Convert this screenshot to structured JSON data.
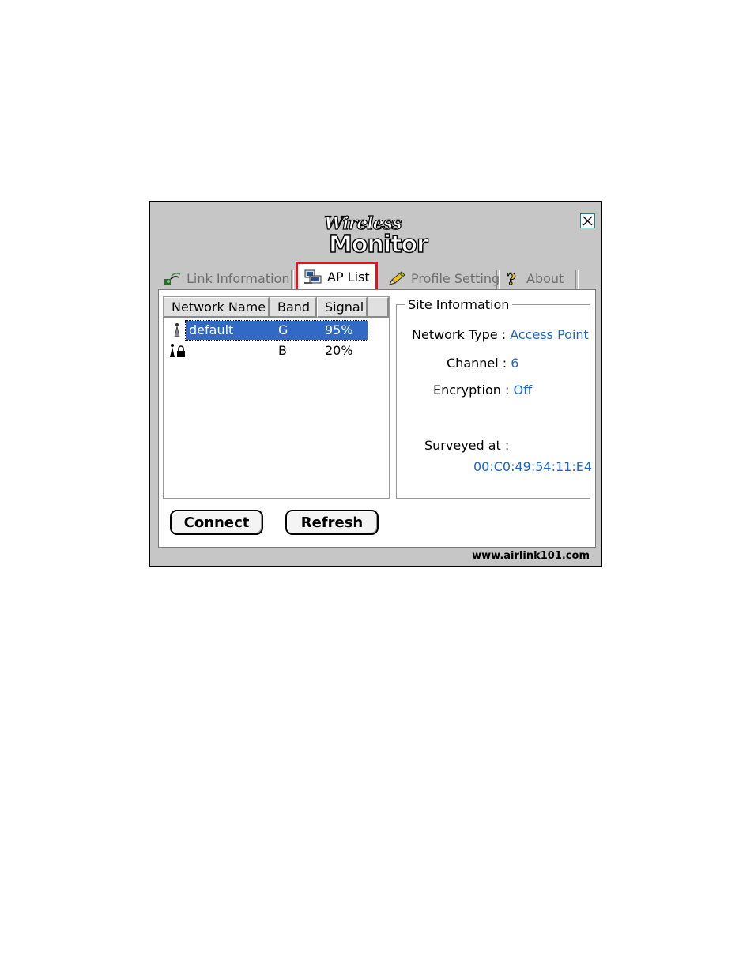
{
  "window": {
    "logo_line1": "Wireless",
    "logo_line2": "Monitor",
    "footer_url": "www.airlink101.com"
  },
  "tabs": [
    {
      "label": "Link Information",
      "icon": "link-signal-icon",
      "active": false
    },
    {
      "label": "AP List",
      "icon": "ap-list-icon",
      "active": true
    },
    {
      "label": "Profile Setting",
      "icon": "pencil-icon",
      "active": false
    },
    {
      "label": "About",
      "icon": "question-icon",
      "active": false
    }
  ],
  "ap_list": {
    "columns": [
      "Network Name",
      "Band",
      "Signal"
    ],
    "rows": [
      {
        "icon": "antenna-icon",
        "name": "default",
        "band": "G",
        "signal": "95%",
        "selected": true
      },
      {
        "icon": "antenna-lock-icon",
        "name": "",
        "band": "B",
        "signal": "20%",
        "selected": false
      }
    ]
  },
  "site_info": {
    "legend": "Site Information",
    "network_type_label": "Network Type :",
    "network_type_value": "Access Point",
    "channel_label": "Channel :",
    "channel_value": "6",
    "encryption_label": "Encryption :",
    "encryption_value": "Off",
    "surveyed_label": "Surveyed at :",
    "surveyed_value": "00:C0:49:54:11:E4"
  },
  "buttons": {
    "connect": "Connect",
    "refresh": "Refresh"
  },
  "colors": {
    "highlight": "#e8101a",
    "selection": "#316ac5",
    "value_text": "#1a66cc"
  }
}
